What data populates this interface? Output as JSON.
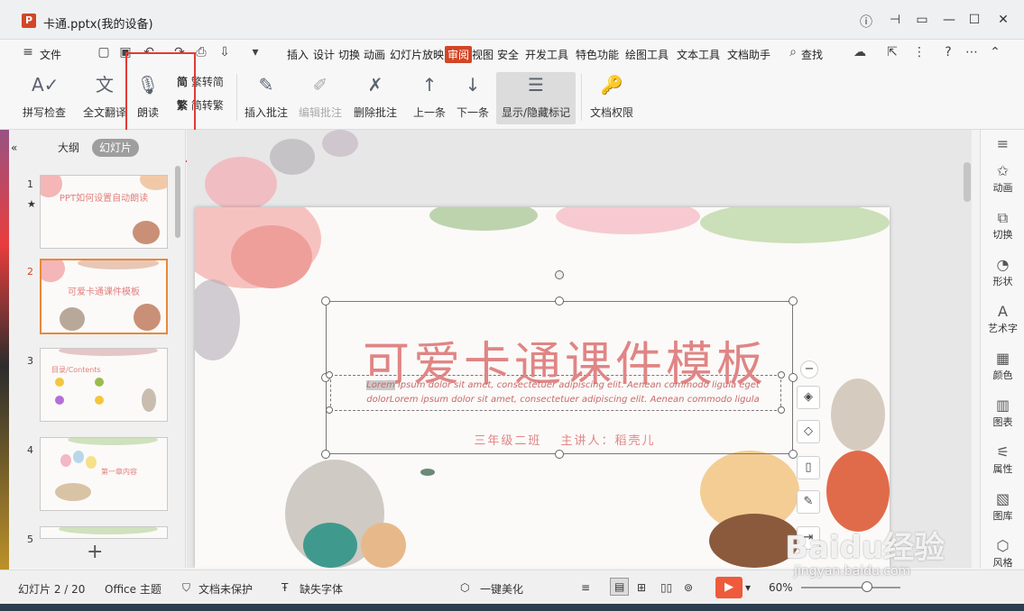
{
  "window": {
    "title": "卡通.pptx(我的设备)",
    "app_logo": "P"
  },
  "menu": {
    "file": "文件",
    "tabs": [
      "插入",
      "设计",
      "切换",
      "动画",
      "幻灯片放映",
      "审阅",
      "视图",
      "安全",
      "开发工具",
      "特色功能",
      "绘图工具",
      "文本工具",
      "文档助手"
    ],
    "active_tab": "审阅",
    "search": "查找"
  },
  "ribbon": {
    "spell_check": "拼写检查",
    "translate": "全文翻译",
    "read_aloud": "朗读",
    "trad_to_simp": "繁转简",
    "simp_to_trad": "简转繁",
    "simp_glyph": "简",
    "trad_glyph": "繁",
    "insert_comment": "插入批注",
    "edit_comment": "编辑批注",
    "delete_comment": "删除批注",
    "prev": "上一条",
    "next": "下一条",
    "show_hide_markup": "显示/隐藏标记",
    "doc_permission": "文档权限"
  },
  "left_panel": {
    "tabs": [
      "大纲",
      "幻灯片"
    ],
    "active_tab": "幻灯片",
    "thumbnails": [
      {
        "num": "1",
        "title": "PPT如何设置自动朗读"
      },
      {
        "num": "2",
        "title": "可爱卡通课件模板"
      },
      {
        "num": "3",
        "title": "目录/Contents"
      },
      {
        "num": "4",
        "title": "第一章内容"
      },
      {
        "num": "5",
        "title": ""
      }
    ],
    "active_slide": 2
  },
  "slide": {
    "title": "可爱卡通课件模板",
    "subtitle_highlight": "Lorem",
    "subtitle_rest": " ipsum dolor sit amet, consectetuer adipiscing elit. Aenean commodo ligula eget dolorLorem ipsum dolor sit amet, consectetuer adipiscing elit. Aenean commodo ligula",
    "info": "三年级二班　 主讲人：稻壳儿"
  },
  "right_panel": [
    "动画",
    "切换",
    "形状",
    "艺术字",
    "颜色",
    "图表",
    "属性",
    "图库",
    "风格"
  ],
  "status": {
    "slide_counter": "幻灯片 2 / 20",
    "theme": "Office 主题",
    "protection": "文档未保护",
    "missing_font": "缺失字体",
    "beautify": "一键美化",
    "zoom": "60%",
    "zoom_level": 0.6
  },
  "watermark": {
    "text": "Baidu经验",
    "url": "jingyan.baidu.com"
  },
  "colors": {
    "accent": "#d24625",
    "slide_title": "#e08585",
    "highlight_box": "#e53935"
  }
}
